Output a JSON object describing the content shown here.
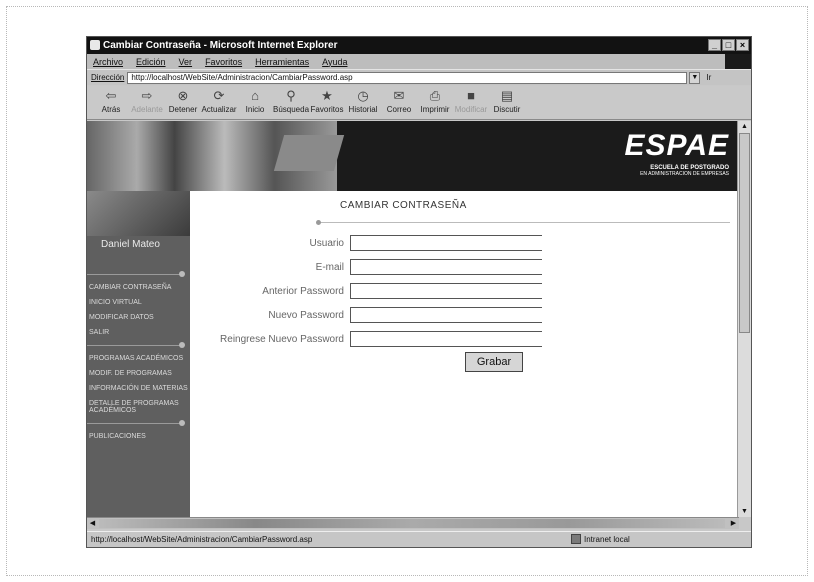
{
  "window": {
    "title": "Cambiar Contraseña - Microsoft Internet Explorer",
    "controls": [
      "_",
      "□",
      "×"
    ]
  },
  "menu": [
    "Archivo",
    "Edición",
    "Ver",
    "Favoritos",
    "Herramientas",
    "Ayuda"
  ],
  "address": {
    "label": "Dirección",
    "url": "http://localhost/WebSite/Administracion/CambiarPassword.asp",
    "go": "Ir"
  },
  "toolbar": [
    {
      "label": "Atrás",
      "icon": "back-arrow-icon"
    },
    {
      "label": "Adelante",
      "icon": "forward-arrow-icon"
    },
    {
      "label": "Detener",
      "icon": "stop-icon"
    },
    {
      "label": "Actualizar",
      "icon": "refresh-icon"
    },
    {
      "label": "Inicio",
      "icon": "home-icon"
    },
    {
      "label": "Búsqueda",
      "icon": "search-icon"
    },
    {
      "label": "Favoritos",
      "icon": "favorites-icon"
    },
    {
      "label": "Historial",
      "icon": "history-icon"
    },
    {
      "label": "Correo",
      "icon": "mail-icon"
    },
    {
      "label": "Imprimir",
      "icon": "print-icon"
    },
    {
      "label": "Modificar",
      "icon": "edit-icon"
    },
    {
      "label": "Discutir",
      "icon": "discuss-icon"
    }
  ],
  "banner": {
    "brand": "ESPAE",
    "sub1": "ESCUELA DE POSTGRADO",
    "sub2": "EN ADMINISTRACION DE EMPRESAS"
  },
  "sidebar": {
    "user": "Daniel Mateo",
    "items": [
      "CAMBIAR CONTRASEÑA",
      "INICIO VIRTUAL",
      "MODIFICAR DATOS",
      "SALIR",
      "PROGRAMAS ACADÉMICOS",
      "MODIF. DE PROGRAMAS",
      "INFORMACIÓN DE MATERIAS",
      "DETALLE DE PROGRAMAS ACADÉMICOS",
      "PUBLICACIONES"
    ]
  },
  "form": {
    "title": "CAMBIAR CONTRASEÑA",
    "fields": [
      {
        "label": "Usuario",
        "value": ""
      },
      {
        "label": "E-mail",
        "value": ""
      },
      {
        "label": "Anterior Password",
        "value": ""
      },
      {
        "label": "Nuevo Password",
        "value": ""
      },
      {
        "label": "Reingrese Nuevo Password",
        "value": ""
      }
    ],
    "submit": "Grabar"
  },
  "status": {
    "url": "http://localhost/WebSite/Administracion/CambiarPassword.asp",
    "zone": "Intranet local"
  }
}
